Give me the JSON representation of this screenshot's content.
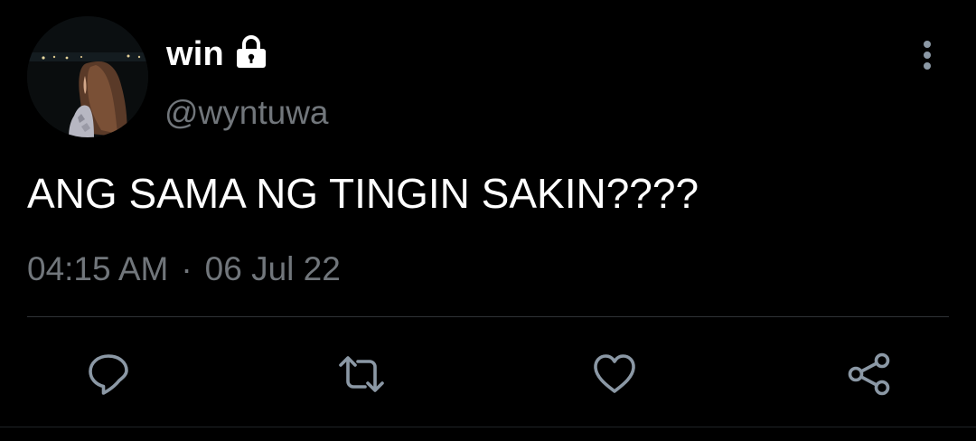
{
  "user": {
    "display_name": "win",
    "handle": "@wyntuwa",
    "protected_icon": "lock-icon",
    "avatar_icon": "profile-photo"
  },
  "tweet": {
    "text": "ANG SAMA NG TINGIN SAKIN????",
    "time": "04:15 AM",
    "separator": "·",
    "date": "06 Jul 22"
  },
  "actions": {
    "more": "more-vertical-icon",
    "reply": "reply-icon",
    "retweet": "retweet-icon",
    "like": "heart-icon",
    "share": "share-icon"
  },
  "colors": {
    "background": "#000000",
    "text_primary": "#ffffff",
    "text_secondary": "#71767b",
    "icon": "#8b98a5",
    "divider": "#2f3336"
  }
}
